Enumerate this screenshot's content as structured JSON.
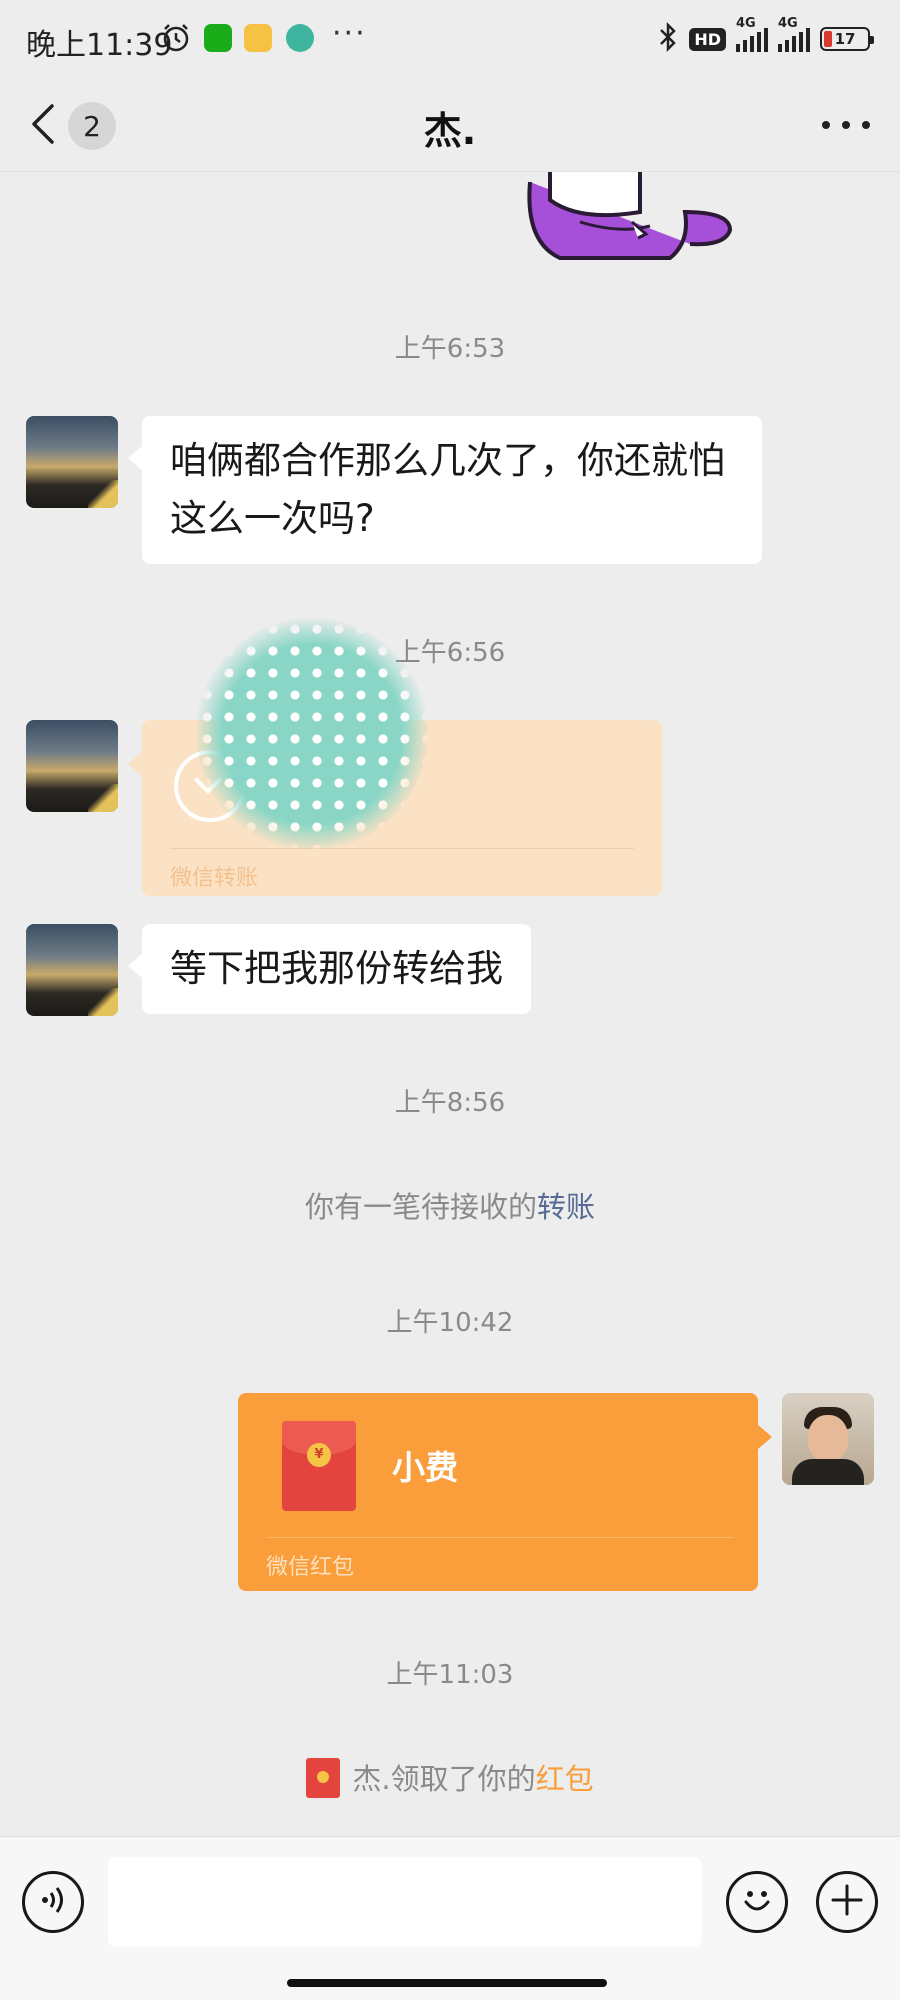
{
  "status_bar": {
    "time": "晚上11:39",
    "more_indicator": "···",
    "network_hd": "HD",
    "network_1": "4G",
    "network_2": "4G",
    "battery": "17"
  },
  "header": {
    "back_badge": "2",
    "title": "杰."
  },
  "messages": {
    "ts1": "上午6:53",
    "msg1": "咱俩都合作那么几次了，你还就怕这么一次吗?",
    "ts2": "上午6:56",
    "transfer_label": "微信转账",
    "msg2": "等下把我那份转给我",
    "ts3": "上午8:56",
    "sys1_text": "你有一笔待接收的",
    "sys1_link": "转账",
    "ts4": "上午10:42",
    "redpacket_title": "小费",
    "redpacket_label": "微信红包",
    "ts5": "上午11:03",
    "sys2_text": "杰.领取了你的",
    "sys2_link": "红包"
  },
  "input": {
    "value": ""
  },
  "colors": {
    "background": "#ededed",
    "bubble": "#ffffff",
    "red_packet": "#fa9d3b",
    "transfer_card": "#fbe2c5",
    "link_blue": "#576b95",
    "link_orange": "#fa9d3b"
  },
  "icons": [
    "alarm-icon",
    "wechat-icon",
    "app-icon",
    "app-icon-2",
    "bluetooth-icon",
    "signal-icon",
    "battery-icon",
    "back-icon",
    "more-icon",
    "voice-icon",
    "emoji-icon",
    "plus-icon",
    "red-packet-icon",
    "transfer-check-icon"
  ]
}
